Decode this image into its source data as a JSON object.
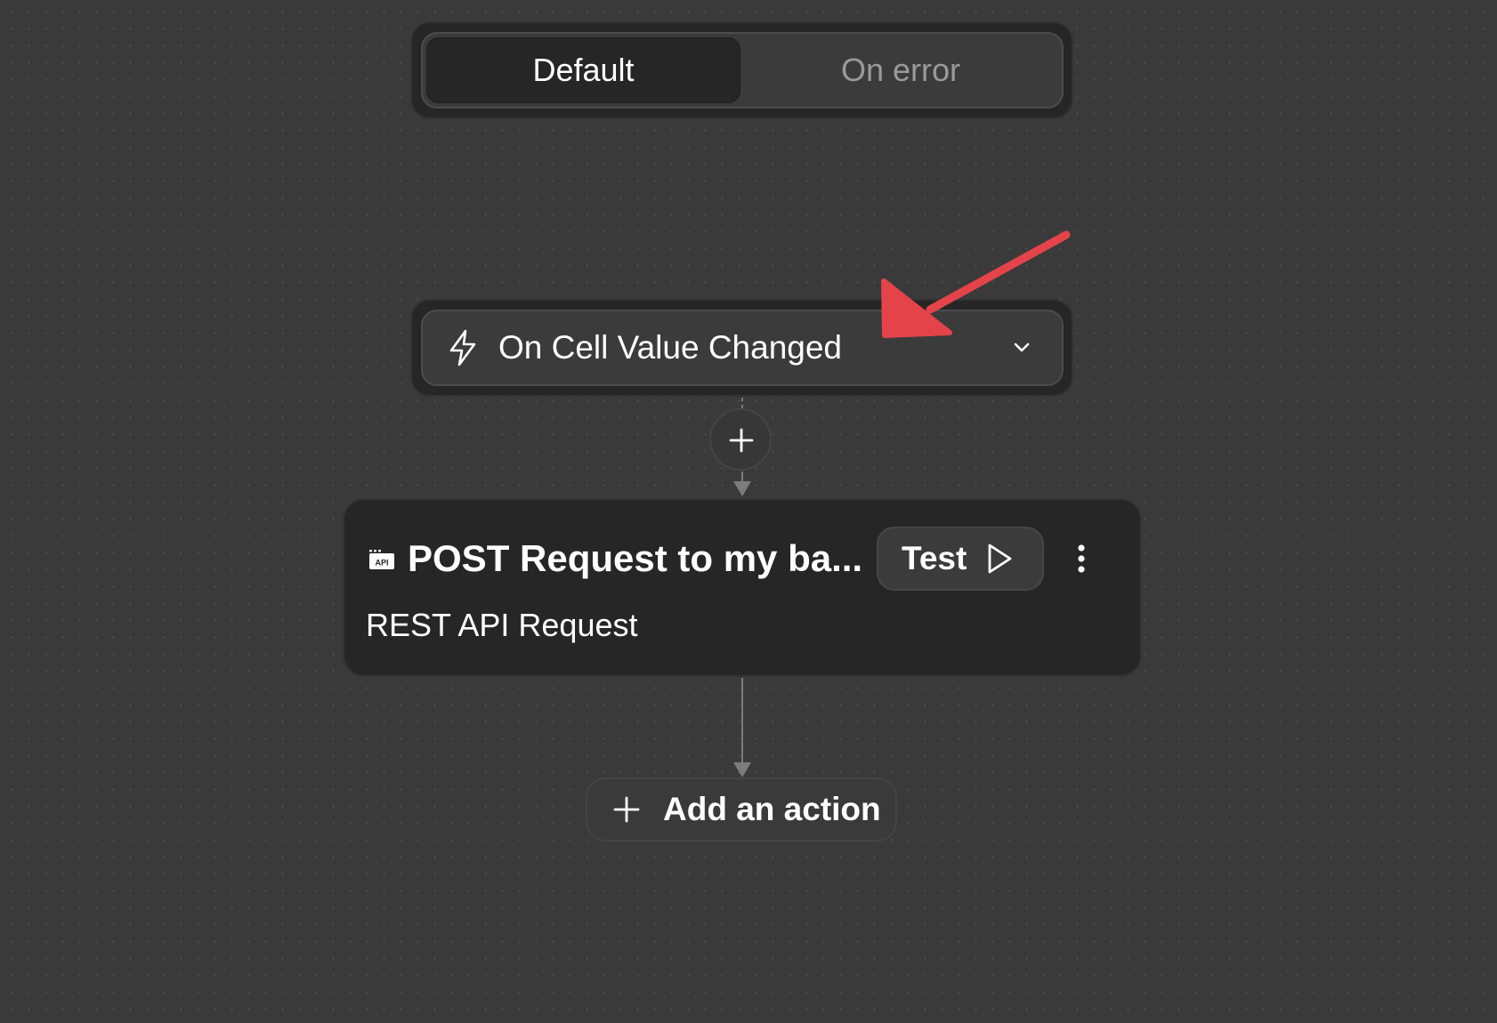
{
  "toggle": {
    "default_label": "Default",
    "on_error_label": "On error",
    "selected": "Default"
  },
  "trigger": {
    "icon": "lightning-bolt-icon",
    "label": "On Cell Value Changed",
    "chevron": "chevron-down-icon"
  },
  "connector": {
    "add_step_icon": "plus-icon"
  },
  "action_card": {
    "icon": "api-icon",
    "title": "POST Request to my ba...",
    "subtitle": "REST API Request",
    "test_label": "Test",
    "test_icon": "play-icon",
    "menu_icon": "more-vertical-icon"
  },
  "add_action": {
    "icon": "plus-icon",
    "label": "Add an action"
  },
  "colors": {
    "canvas": "#3a3a3a",
    "card": "#262626",
    "annotation_arrow": "#e5434a"
  }
}
